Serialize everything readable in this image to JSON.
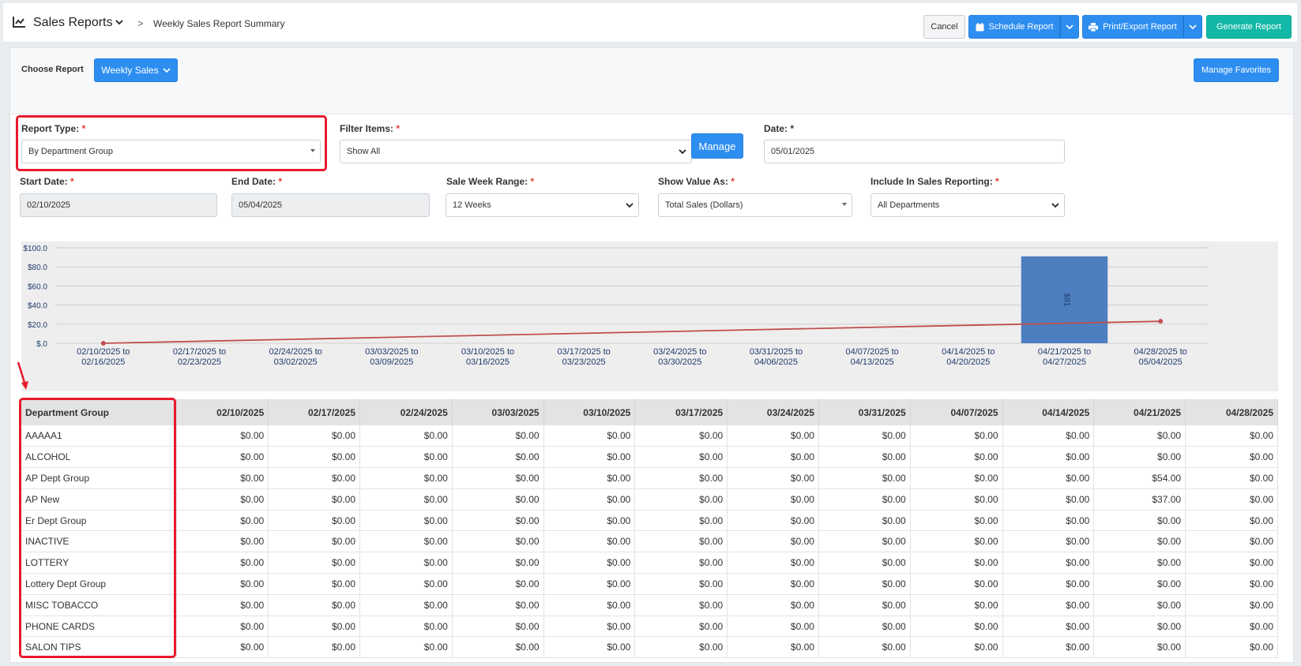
{
  "header": {
    "title": "Sales Reports",
    "subtitle": "Weekly Sales Report Summary",
    "separator": ">",
    "cancel_label": "Cancel",
    "schedule_label": "Schedule Report",
    "print_label": "Print/Export Report",
    "generate_label": "Generate Report"
  },
  "choose": {
    "label": "Choose Report",
    "selected": "Weekly Sales",
    "favorites_label": "Manage Favorites"
  },
  "form": {
    "report_type_label": "Report Type:",
    "report_type_value": "By Department Group",
    "filter_label": "Filter Items:",
    "filter_value": "Show All",
    "manage_label": "Manage",
    "date_label": "Date:",
    "date_value": "05/01/2025",
    "start_label": "Start Date:",
    "start_value": "02/10/2025",
    "end_label": "End Date:",
    "end_value": "05/04/2025",
    "range_label": "Sale Week Range:",
    "range_value": "12 Weeks",
    "show_label": "Show Value As:",
    "show_value": "Total Sales (Dollars)",
    "include_label": "Include In Sales Reporting:",
    "include_value": "All Departments",
    "required_mark": "*"
  },
  "chart_data": {
    "type": "bar",
    "categories": [
      [
        "02/10/2025 to",
        "02/16/2025"
      ],
      [
        "02/17/2025 to",
        "02/23/2025"
      ],
      [
        "02/24/2025 to",
        "03/02/2025"
      ],
      [
        "03/03/2025 to",
        "03/09/2025"
      ],
      [
        "03/10/2025 to",
        "03/16/2025"
      ],
      [
        "03/17/2025 to",
        "03/23/2025"
      ],
      [
        "03/24/2025 to",
        "03/30/2025"
      ],
      [
        "03/31/2025 to",
        "04/06/2025"
      ],
      [
        "04/07/2025 to",
        "04/13/2025"
      ],
      [
        "04/14/2025 to",
        "04/20/2025"
      ],
      [
        "04/21/2025 to",
        "04/27/2025"
      ],
      [
        "04/28/2025 to",
        "05/04/2025"
      ]
    ],
    "values": [
      0,
      0,
      0,
      0,
      0,
      0,
      0,
      0,
      0,
      0,
      91,
      0
    ],
    "bar_label": "$91",
    "trend_line": {
      "start": 0,
      "end": 23
    },
    "ylim": [
      0,
      100
    ],
    "yticks": [
      "$.0",
      "$20.0",
      "$40.0",
      "$60.0",
      "$80.0",
      "$100.0"
    ],
    "bar_color": "#4d7ebf",
    "line_color": "#c0504d",
    "grid": true
  },
  "table": {
    "headers": [
      "Department Group",
      "02/10/2025",
      "02/17/2025",
      "02/24/2025",
      "03/03/2025",
      "03/10/2025",
      "03/17/2025",
      "03/24/2025",
      "03/31/2025",
      "04/07/2025",
      "04/14/2025",
      "04/21/2025",
      "04/28/2025"
    ],
    "rows": [
      [
        "AAAAA1",
        "$0.00",
        "$0.00",
        "$0.00",
        "$0.00",
        "$0.00",
        "$0.00",
        "$0.00",
        "$0.00",
        "$0.00",
        "$0.00",
        "$0.00",
        "$0.00"
      ],
      [
        "ALCOHOL",
        "$0.00",
        "$0.00",
        "$0.00",
        "$0.00",
        "$0.00",
        "$0.00",
        "$0.00",
        "$0.00",
        "$0.00",
        "$0.00",
        "$0.00",
        "$0.00"
      ],
      [
        "AP Dept Group",
        "$0.00",
        "$0.00",
        "$0.00",
        "$0.00",
        "$0.00",
        "$0.00",
        "$0.00",
        "$0.00",
        "$0.00",
        "$0.00",
        "$54.00",
        "$0.00"
      ],
      [
        "AP New",
        "$0.00",
        "$0.00",
        "$0.00",
        "$0.00",
        "$0.00",
        "$0.00",
        "$0.00",
        "$0.00",
        "$0.00",
        "$0.00",
        "$37.00",
        "$0.00"
      ],
      [
        "Er Dept Group",
        "$0.00",
        "$0.00",
        "$0.00",
        "$0.00",
        "$0.00",
        "$0.00",
        "$0.00",
        "$0.00",
        "$0.00",
        "$0.00",
        "$0.00",
        "$0.00"
      ],
      [
        "INACTIVE",
        "$0.00",
        "$0.00",
        "$0.00",
        "$0.00",
        "$0.00",
        "$0.00",
        "$0.00",
        "$0.00",
        "$0.00",
        "$0.00",
        "$0.00",
        "$0.00"
      ],
      [
        "LOTTERY",
        "$0.00",
        "$0.00",
        "$0.00",
        "$0.00",
        "$0.00",
        "$0.00",
        "$0.00",
        "$0.00",
        "$0.00",
        "$0.00",
        "$0.00",
        "$0.00"
      ],
      [
        "Lottery Dept Group",
        "$0.00",
        "$0.00",
        "$0.00",
        "$0.00",
        "$0.00",
        "$0.00",
        "$0.00",
        "$0.00",
        "$0.00",
        "$0.00",
        "$0.00",
        "$0.00"
      ],
      [
        "MISC TOBACCO",
        "$0.00",
        "$0.00",
        "$0.00",
        "$0.00",
        "$0.00",
        "$0.00",
        "$0.00",
        "$0.00",
        "$0.00",
        "$0.00",
        "$0.00",
        "$0.00"
      ],
      [
        "PHONE CARDS",
        "$0.00",
        "$0.00",
        "$0.00",
        "$0.00",
        "$0.00",
        "$0.00",
        "$0.00",
        "$0.00",
        "$0.00",
        "$0.00",
        "$0.00",
        "$0.00"
      ],
      [
        "SALON TIPS",
        "$0.00",
        "$0.00",
        "$0.00",
        "$0.00",
        "$0.00",
        "$0.00",
        "$0.00",
        "$0.00",
        "$0.00",
        "$0.00",
        "$0.00",
        "$0.00"
      ]
    ]
  },
  "colors": {
    "primary": "#2d8ef0",
    "generate": "#14b8a6",
    "highlight": "#e8192c"
  }
}
